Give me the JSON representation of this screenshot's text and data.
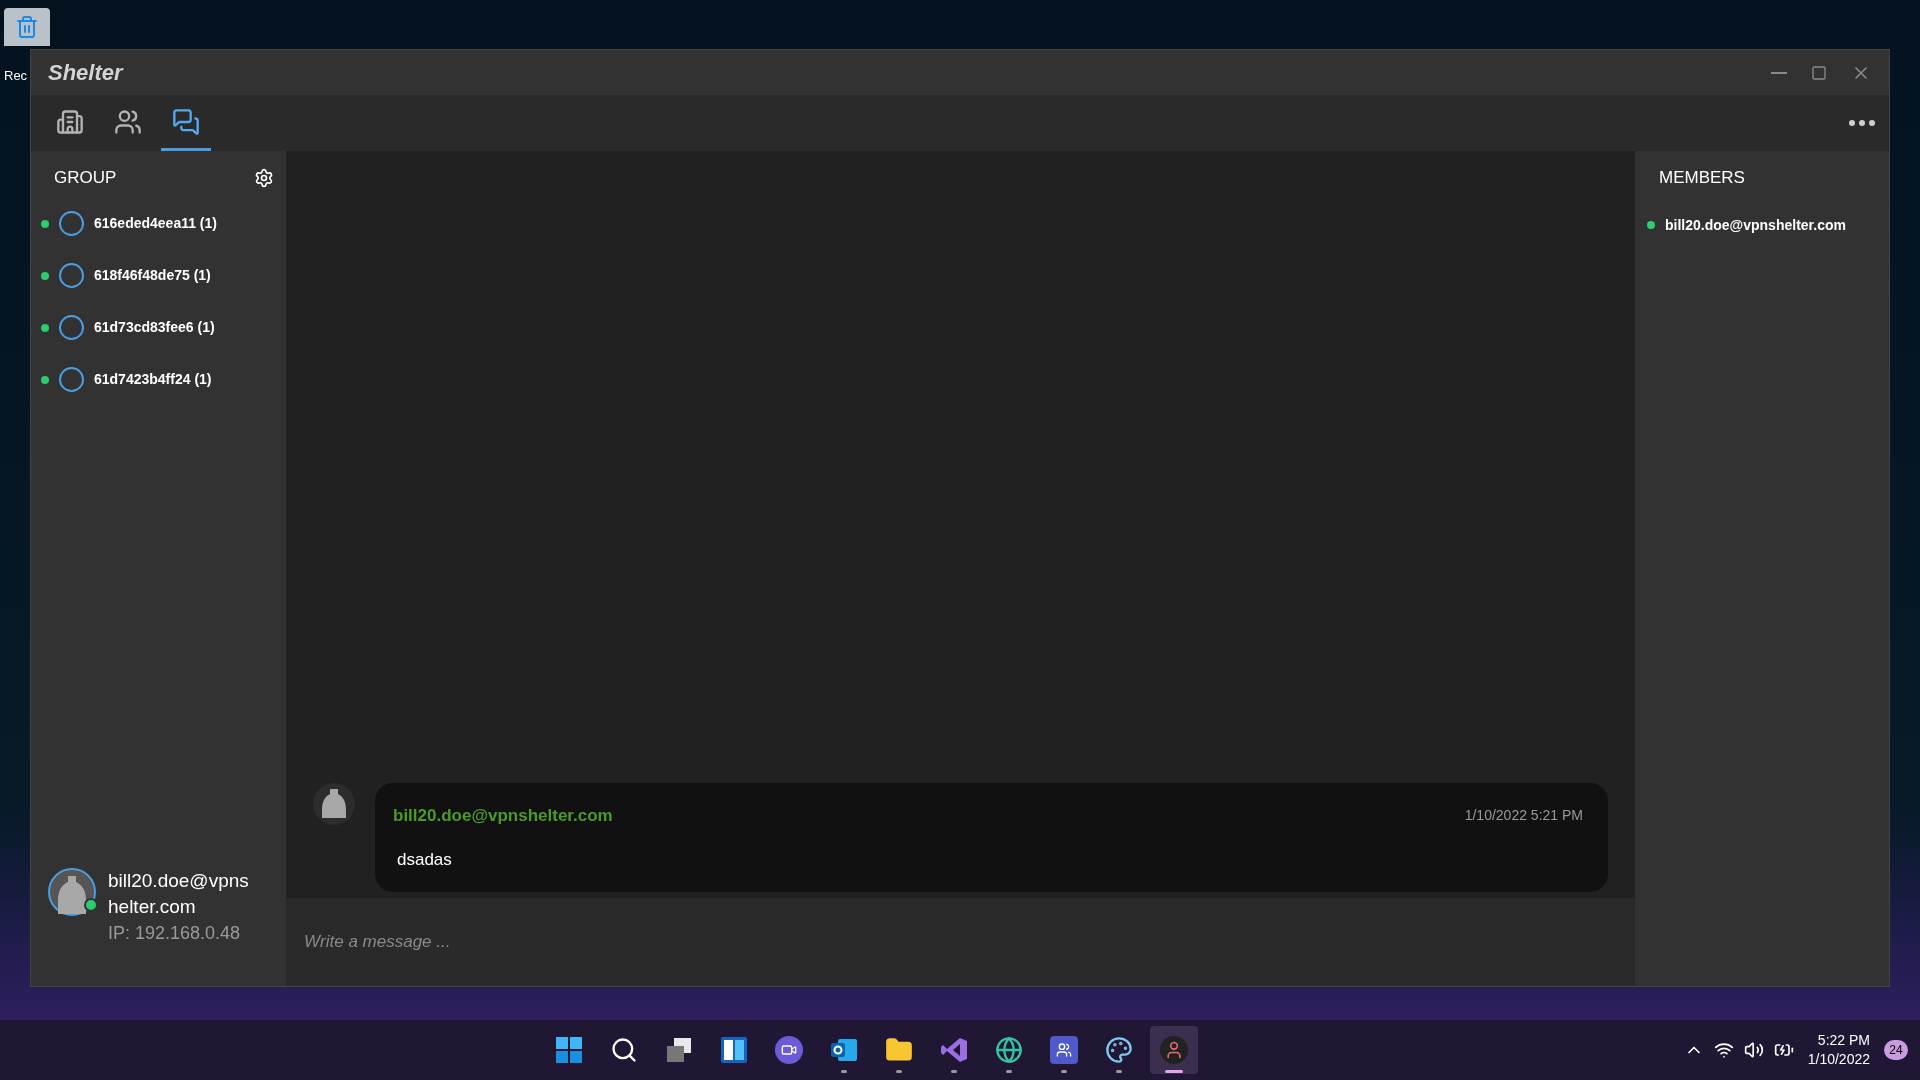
{
  "desktop": {
    "icon_label": "Rec"
  },
  "window": {
    "title": "Shelter"
  },
  "tabs": [
    {
      "kind": "building",
      "selected": false
    },
    {
      "kind": "people",
      "selected": false
    },
    {
      "kind": "chat",
      "selected": true
    }
  ],
  "groups_panel": {
    "title": "GROUP",
    "groups": [
      {
        "name": "616eded4eea11 (1)",
        "online": true
      },
      {
        "name": "618f46f48de75 (1)",
        "online": true
      },
      {
        "name": "61d73cd83fee6 (1)",
        "online": true
      },
      {
        "name": "61d7423b4ff24 (1)",
        "online": true
      }
    ]
  },
  "profile": {
    "name": "bill20.doe@vpnshelter.com",
    "ip": "IP: 192.168.0.48",
    "online": true
  },
  "messages": [
    {
      "author": "bill20.doe@vpnshelter.com",
      "time": "1/10/2022 5:21 PM",
      "text": "dsadas"
    }
  ],
  "composer": {
    "placeholder": "Write a message ..."
  },
  "members_panel": {
    "title": "MEMBERS",
    "members": [
      {
        "name": "bill20.doe@vpnshelter.com",
        "online": true
      }
    ]
  },
  "taskbar": {
    "apps": [
      {
        "kind": "start",
        "running": false,
        "selected": false
      },
      {
        "kind": "search",
        "running": false,
        "selected": false
      },
      {
        "kind": "taskview",
        "running": false,
        "selected": false
      },
      {
        "kind": "widgets",
        "running": false,
        "selected": false
      },
      {
        "kind": "meet",
        "running": false,
        "selected": false
      },
      {
        "kind": "mail",
        "running": true,
        "selected": false
      },
      {
        "kind": "folder",
        "running": true,
        "selected": false
      },
      {
        "kind": "code",
        "running": true,
        "selected": false
      },
      {
        "kind": "browser",
        "running": true,
        "selected": false
      },
      {
        "kind": "teams",
        "running": true,
        "selected": false
      },
      {
        "kind": "paint",
        "running": true,
        "selected": false
      },
      {
        "kind": "avatar",
        "running": true,
        "selected": true
      }
    ],
    "time": "5:22 PM",
    "date": "1/10/2022",
    "notifications": "24"
  }
}
